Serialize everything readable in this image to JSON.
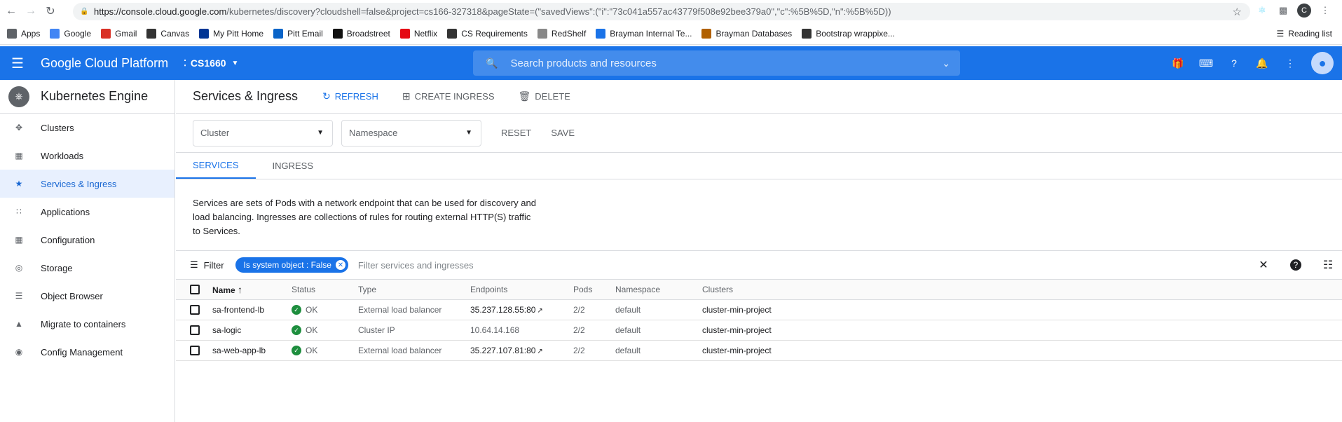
{
  "browser": {
    "url_host": "https://console.cloud.google.com",
    "url_path": "/kubernetes/discovery?cloudshell=false&project=cs166-327318&pageState=(\"savedViews\":(\"i\":\"73c041a557ac43779f508e92bee379a0\",\"c\":%5B%5D,\"n\":%5B%5D))",
    "profile_initial": "C"
  },
  "bookmarks": [
    {
      "label": "Apps",
      "icon": "apps-grid-icon",
      "color": "#5f6368"
    },
    {
      "label": "Google",
      "icon": "google-icon",
      "color": "#4285f4"
    },
    {
      "label": "Gmail",
      "icon": "gmail-icon",
      "color": "#d93025"
    },
    {
      "label": "Canvas",
      "icon": "canvas-icon",
      "color": "#333333"
    },
    {
      "label": "My Pitt Home",
      "icon": "pitt-icon",
      "color": "#003594"
    },
    {
      "label": "Pitt Email",
      "icon": "outlook-icon",
      "color": "#0a64c8"
    },
    {
      "label": "Broadstreet",
      "icon": "broadstreet-icon",
      "color": "#111111"
    },
    {
      "label": "Netflix",
      "icon": "netflix-icon",
      "color": "#e50914"
    },
    {
      "label": "CS Requirements",
      "icon": "cs-icon",
      "color": "#333333"
    },
    {
      "label": "RedShelf",
      "icon": "redshelf-icon",
      "color": "#888888"
    },
    {
      "label": "Brayman Internal Te...",
      "icon": "brayman-icon",
      "color": "#1a73e8"
    },
    {
      "label": "Brayman Databases",
      "icon": "brayman-db-icon",
      "color": "#b06000"
    },
    {
      "label": "Bootstrap wrappixe...",
      "icon": "bootstrap-icon",
      "color": "#333333"
    }
  ],
  "reading_list": "Reading list",
  "header": {
    "product": "Google Cloud Platform",
    "project": "CS1660",
    "search_placeholder": "Search products and resources"
  },
  "sidebar": {
    "title": "Kubernetes Engine",
    "items": [
      {
        "label": "Clusters",
        "icon": "clusters-icon"
      },
      {
        "label": "Workloads",
        "icon": "workloads-icon"
      },
      {
        "label": "Services & Ingress",
        "icon": "services-icon",
        "active": true
      },
      {
        "label": "Applications",
        "icon": "applications-icon"
      },
      {
        "label": "Configuration",
        "icon": "configuration-icon"
      },
      {
        "label": "Storage",
        "icon": "storage-icon"
      },
      {
        "label": "Object Browser",
        "icon": "object-browser-icon"
      },
      {
        "label": "Migrate to containers",
        "icon": "migrate-icon"
      },
      {
        "label": "Config Management",
        "icon": "config-management-icon"
      }
    ]
  },
  "toolbar": {
    "title": "Services & Ingress",
    "refresh": "REFRESH",
    "create_ingress": "CREATE INGRESS",
    "delete": "DELETE"
  },
  "filters": {
    "cluster_placeholder": "Cluster",
    "namespace_placeholder": "Namespace",
    "reset": "RESET",
    "save": "SAVE"
  },
  "tabs": [
    "SERVICES",
    "INGRESS"
  ],
  "description": "Services are sets of Pods with a network endpoint that can be used for discovery and load balancing. Ingresses are collections of rules for routing external HTTP(S) traffic to Services.",
  "filterbar": {
    "label": "Filter",
    "chip": "Is system object : False",
    "placeholder": "Filter services and ingresses"
  },
  "table": {
    "columns": [
      "Name",
      "Status",
      "Type",
      "Endpoints",
      "Pods",
      "Namespace",
      "Clusters"
    ],
    "rows": [
      {
        "name": "sa-frontend-lb",
        "status": "OK",
        "type": "External load balancer",
        "endpoints": "35.237.128.55:80",
        "external": true,
        "pods": "2/2",
        "namespace": "default",
        "cluster": "cluster-min-project"
      },
      {
        "name": "sa-logic",
        "status": "OK",
        "type": "Cluster IP",
        "endpoints": "10.64.14.168",
        "external": false,
        "pods": "2/2",
        "namespace": "default",
        "cluster": "cluster-min-project"
      },
      {
        "name": "sa-web-app-lb",
        "status": "OK",
        "type": "External load balancer",
        "endpoints": "35.227.107.81:80",
        "external": true,
        "pods": "2/2",
        "namespace": "default",
        "cluster": "cluster-min-project"
      }
    ]
  },
  "colors": {
    "brand_blue": "#1a73e8",
    "ok_green": "#1e8e3e",
    "active_bg": "#e8f0fe"
  }
}
